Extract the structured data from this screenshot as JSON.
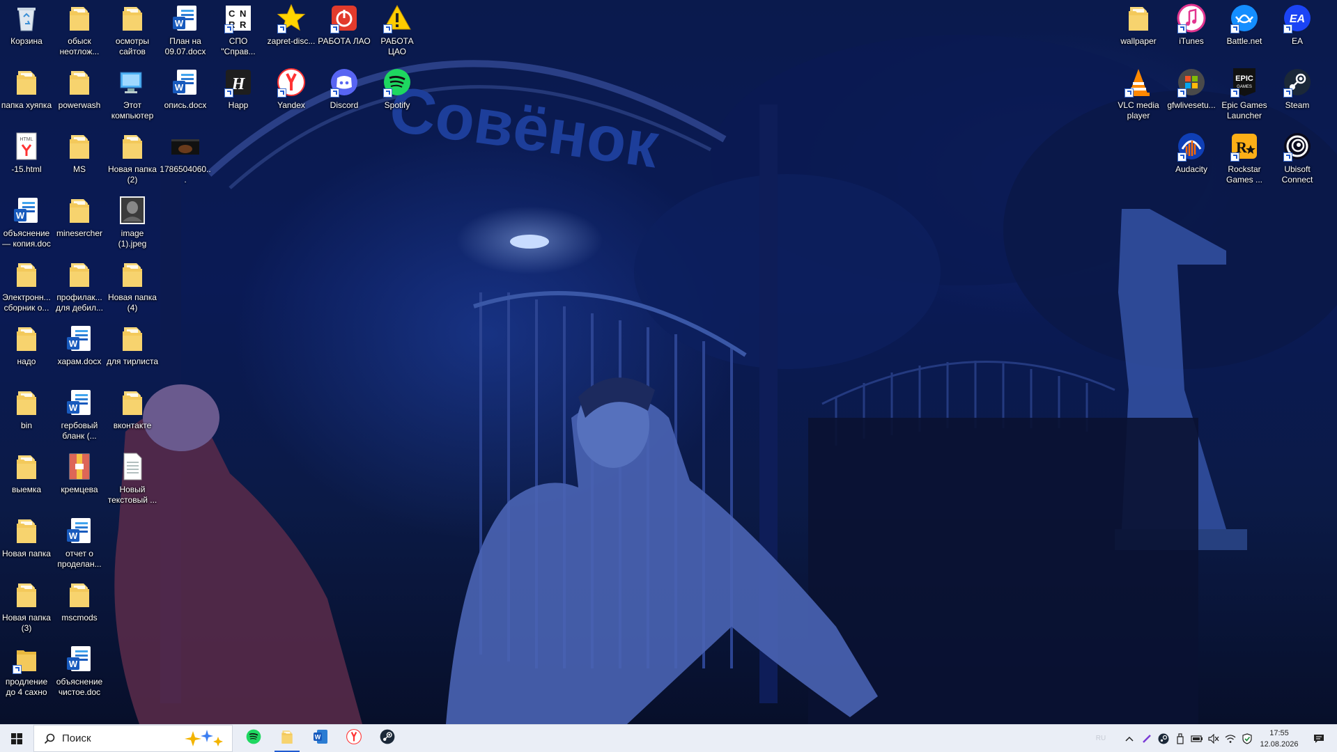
{
  "desktop": {
    "icons": [
      {
        "label": "Корзина",
        "icon": "recycle-bin-icon"
      },
      {
        "label": "обыск неотлож...",
        "icon": "folder-icon"
      },
      {
        "label": "осмотры сайтов",
        "icon": "folder-icon"
      },
      {
        "label": "План на 09.07.docx",
        "icon": "word-document-icon"
      },
      {
        "label": "СПО \"Справ...",
        "icon": "spo-app-icon"
      },
      {
        "label": "zapret-disc...",
        "icon": "star-icon"
      },
      {
        "label": "РАБОТА ЛАО",
        "icon": "power-icon"
      },
      {
        "label": "РАБОТА ЦАО",
        "icon": "warning-icon"
      },
      {
        "label": "папка хуяпка",
        "icon": "folder-icon"
      },
      {
        "label": "powerwash",
        "icon": "folder-icon"
      },
      {
        "label": "Этот компьютер",
        "icon": "this-pc-icon"
      },
      {
        "label": "опись.docx",
        "icon": "word-document-icon"
      },
      {
        "label": "Happ",
        "icon": "happ-icon"
      },
      {
        "label": "Yandex",
        "icon": "yandex-browser-icon"
      },
      {
        "label": "Discord",
        "icon": "discord-icon"
      },
      {
        "label": "Spotify",
        "icon": "spotify-icon"
      },
      {
        "label": "-15.html",
        "icon": "html-file-icon"
      },
      {
        "label": "MS",
        "icon": "folder-icon"
      },
      {
        "label": "Новая папка (2)",
        "icon": "folder-icon"
      },
      {
        "label": "1786504060...",
        "icon": "video-thumbnail-icon"
      },
      {
        "label": "объяснение — копия.doc",
        "icon": "word-document-icon"
      },
      {
        "label": "minesercher",
        "icon": "folder-icon"
      },
      {
        "label": "image (1).jpeg",
        "icon": "image-thumbnail-icon"
      },
      {
        "label": "Электронн... сборник о...",
        "icon": "folder-icon"
      },
      {
        "label": "профилак... для дебил...",
        "icon": "folder-icon"
      },
      {
        "label": "Новая папка (4)",
        "icon": "folder-icon"
      },
      {
        "label": "надо",
        "icon": "folder-icon"
      },
      {
        "label": "харам.docx",
        "icon": "word-document-icon"
      },
      {
        "label": "для тирлиста",
        "icon": "folder-icon"
      },
      {
        "label": "bin",
        "icon": "folder-icon"
      },
      {
        "label": "гербовый бланк (...",
        "icon": "word-document-icon"
      },
      {
        "label": "вконтакте",
        "icon": "folder-icon"
      },
      {
        "label": "выемка",
        "icon": "folder-icon"
      },
      {
        "label": "кремцева",
        "icon": "archive-icon"
      },
      {
        "label": "Новый текстовый ...",
        "icon": "text-file-icon"
      },
      {
        "label": "Новая папка",
        "icon": "folder-icon"
      },
      {
        "label": "отчет о проделан...",
        "icon": "word-document-icon"
      },
      {
        "label": "Новая папка (3)",
        "icon": "folder-icon"
      },
      {
        "label": "mscmods",
        "icon": "folder-icon"
      },
      {
        "label": "продление до 4 сахно",
        "icon": "folder-shortcut-icon"
      },
      {
        "label": "объяснение чистое.doc",
        "icon": "word-document-icon"
      },
      {
        "label": "wallpaper",
        "icon": "folder-icon"
      },
      {
        "label": "iTunes",
        "icon": "itunes-icon"
      },
      {
        "label": "Battle.net",
        "icon": "battlenet-icon"
      },
      {
        "label": "EA",
        "icon": "ea-icon"
      },
      {
        "label": "VLC media player",
        "icon": "vlc-icon"
      },
      {
        "label": "gfwlivesetu...",
        "icon": "windows-live-icon"
      },
      {
        "label": "Epic Games Launcher",
        "icon": "epic-games-icon"
      },
      {
        "label": "Steam",
        "icon": "steam-icon"
      },
      {
        "label": "Audacity",
        "icon": "audacity-icon"
      },
      {
        "label": "Rockstar Games ...",
        "icon": "rockstar-icon"
      },
      {
        "label": "Ubisoft Connect",
        "icon": "ubisoft-icon"
      }
    ]
  },
  "wallpaper": {
    "sign_text": "Совёнок"
  },
  "taskbar": {
    "search_placeholder": "Поиск",
    "pinned": [
      {
        "name": "spotify",
        "icon": "spotify-icon"
      },
      {
        "name": "file-explorer",
        "icon": "folder-icon"
      },
      {
        "name": "word",
        "icon": "word-icon"
      },
      {
        "name": "yandex",
        "icon": "yandex-browser-icon"
      },
      {
        "name": "steam",
        "icon": "steam-icon"
      }
    ],
    "language": "RU",
    "time": "17:55",
    "date": "12.08.2026"
  },
  "colors": {
    "accent": "#1f5ad1",
    "taskbar": "#eaeef6",
    "folder": "#f3c95b"
  }
}
